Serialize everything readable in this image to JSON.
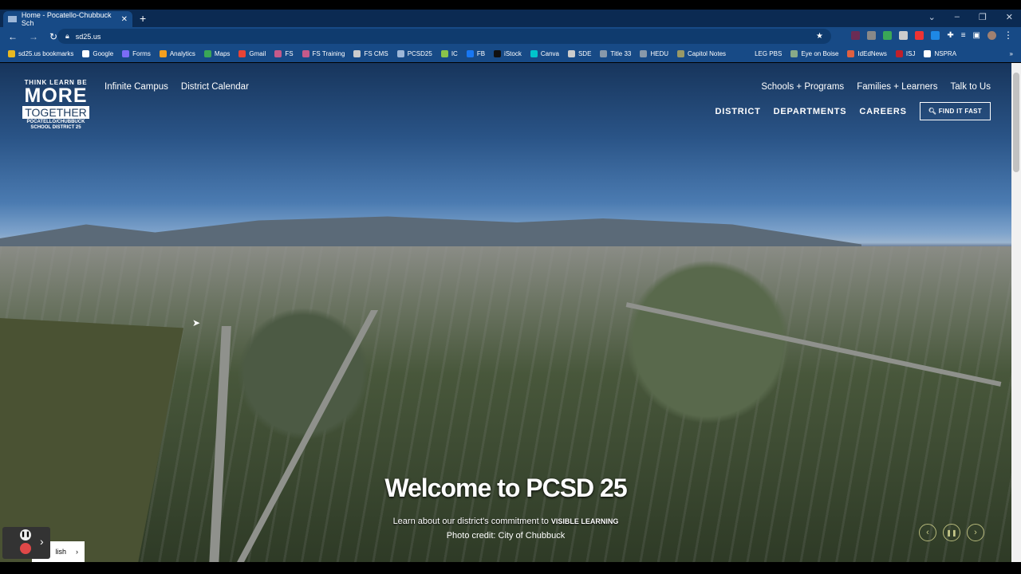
{
  "browser": {
    "tab_title": "Home - Pocatello-Chubbuck Sch",
    "url": "sd25.us",
    "bookmarks": [
      "sd25.us bookmarks",
      "Google",
      "Forms",
      "Analytics",
      "Maps",
      "Gmail",
      "FS",
      "FS Training",
      "FS CMS",
      "PCSD25",
      "IC",
      "FB",
      "iStock",
      "Canva",
      "SDE",
      "Title 33",
      "HEDU",
      "Capitol Notes",
      "LEG PBS",
      "Eye on Boise",
      "IdEdNews",
      "ISJ",
      "NSPRA"
    ],
    "bookmark_colors": [
      "#e8b820",
      "#ffffff",
      "#7b6cf6",
      "#f4a020",
      "#3aa757",
      "#ea4335",
      "#c55a8a",
      "#c55a8a",
      "#cccccc",
      "#9db7d8",
      "#8bc34a",
      "#1877f2",
      "#111111",
      "#00c4cc",
      "#cccccc",
      "#8899aa",
      "#8899aa",
      "#999966",
      "#174a86",
      "#88aa88",
      "#e06040",
      "#c0202a",
      "#ffffff"
    ]
  },
  "site": {
    "logo": {
      "line1": "THINK LEARN BE",
      "line2": "MORE",
      "line3": "TOGETHER",
      "line4": "POCATELLO/CHUBBUCK",
      "line5": "SCHOOL DISTRICT 25"
    },
    "top_links": [
      "Infinite Campus",
      "District Calendar"
    ],
    "right_links": [
      "Schools + Programs",
      "Families + Learners",
      "Talk to Us"
    ],
    "main_nav": [
      "DISTRICT",
      "DEPARTMENTS",
      "CAREERS"
    ],
    "find_it_fast": "FIND IT FAST",
    "hero": {
      "title": "Welcome to PCSD 25",
      "subtitle": "Learn about our district's commitment to",
      "subtitle_bold": "VISIBLE LEARNING",
      "credit": "Photo credit: City of Chubbuck"
    },
    "language": "lish"
  }
}
